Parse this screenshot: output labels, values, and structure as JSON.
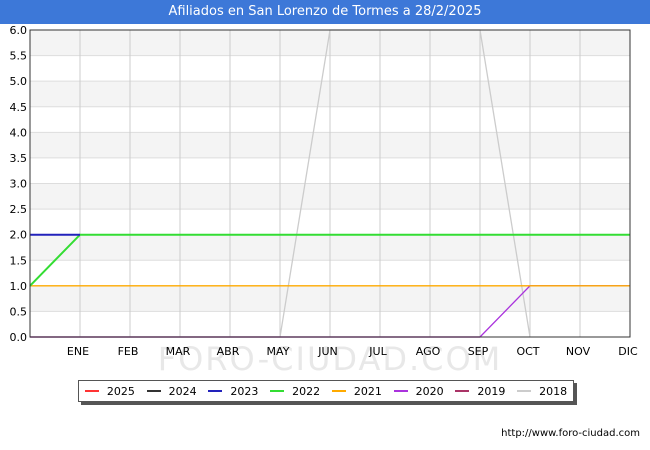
{
  "title": "Afiliados en San Lorenzo de Tormes a 28/2/2025",
  "source": "http://www.foro-ciudad.com",
  "watermark": "FORO-CIUDAD.COM",
  "chart_data": {
    "type": "line",
    "title": "Afiliados en San Lorenzo de Tormes a 28/2/2025",
    "x_labels": [
      "ENE",
      "FEB",
      "MAR",
      "ABR",
      "MAY",
      "JUN",
      "JUL",
      "AGO",
      "SEP",
      "OCT",
      "NOV",
      "DIC"
    ],
    "y_ticks": [
      "0.0",
      "0.5",
      "1.0",
      "1.5",
      "2.0",
      "2.5",
      "3.0",
      "3.5",
      "4.0",
      "4.5",
      "5.0",
      "5.5",
      "6.0"
    ],
    "ylim": [
      0,
      6
    ],
    "grid": true,
    "legend_position": "bottom",
    "series": [
      {
        "name": "2025",
        "color": "#ff3333",
        "points": []
      },
      {
        "name": "2024",
        "color": "#333333",
        "points": []
      },
      {
        "name": "2023",
        "color": "#2222bb",
        "points": [
          [
            0,
            2
          ],
          [
            1,
            2
          ]
        ]
      },
      {
        "name": "2022",
        "color": "#33dd33",
        "points": [
          [
            0,
            1
          ],
          [
            1,
            2
          ],
          [
            2,
            2
          ],
          [
            3,
            2
          ],
          [
            4,
            2
          ],
          [
            5,
            2
          ],
          [
            6,
            2
          ],
          [
            7,
            2
          ],
          [
            8,
            2
          ],
          [
            9,
            2
          ],
          [
            10,
            2
          ],
          [
            11,
            2
          ],
          [
            12,
            2
          ]
        ]
      },
      {
        "name": "2021",
        "color": "#ffaa00",
        "points": [
          [
            0,
            1
          ],
          [
            1,
            1
          ],
          [
            2,
            1
          ],
          [
            3,
            1
          ],
          [
            4,
            1
          ],
          [
            5,
            1
          ],
          [
            6,
            1
          ],
          [
            7,
            1
          ],
          [
            8,
            1
          ],
          [
            9,
            1
          ],
          [
            10,
            1
          ],
          [
            11,
            1
          ],
          [
            12,
            1
          ]
        ]
      },
      {
        "name": "2020",
        "color": "#aa33dd",
        "points": [
          [
            0,
            0
          ],
          [
            1,
            0
          ],
          [
            2,
            0
          ],
          [
            3,
            0
          ],
          [
            4,
            0
          ],
          [
            5,
            0
          ],
          [
            6,
            0
          ],
          [
            7,
            0
          ],
          [
            8,
            0
          ],
          [
            9,
            0
          ],
          [
            10,
            1
          ],
          [
            11,
            1
          ],
          [
            12,
            1
          ]
        ]
      },
      {
        "name": "2019",
        "color": "#aa3366",
        "points": [
          [
            0,
            0
          ],
          [
            1,
            0
          ],
          [
            2,
            0
          ],
          [
            3,
            0
          ],
          [
            4,
            0
          ],
          [
            5,
            0
          ],
          [
            6,
            0
          ],
          [
            7,
            0
          ],
          [
            8,
            0
          ],
          [
            9,
            0
          ]
        ]
      },
      {
        "name": "2018",
        "color": "#cccccc",
        "points": [
          [
            0,
            0
          ],
          [
            1,
            0
          ],
          [
            2,
            0
          ],
          [
            3,
            0
          ],
          [
            4,
            0
          ],
          [
            5,
            0
          ],
          [
            6,
            6
          ],
          [
            7,
            6
          ],
          [
            8,
            6
          ],
          [
            9,
            6
          ],
          [
            10,
            0
          ]
        ]
      }
    ]
  }
}
